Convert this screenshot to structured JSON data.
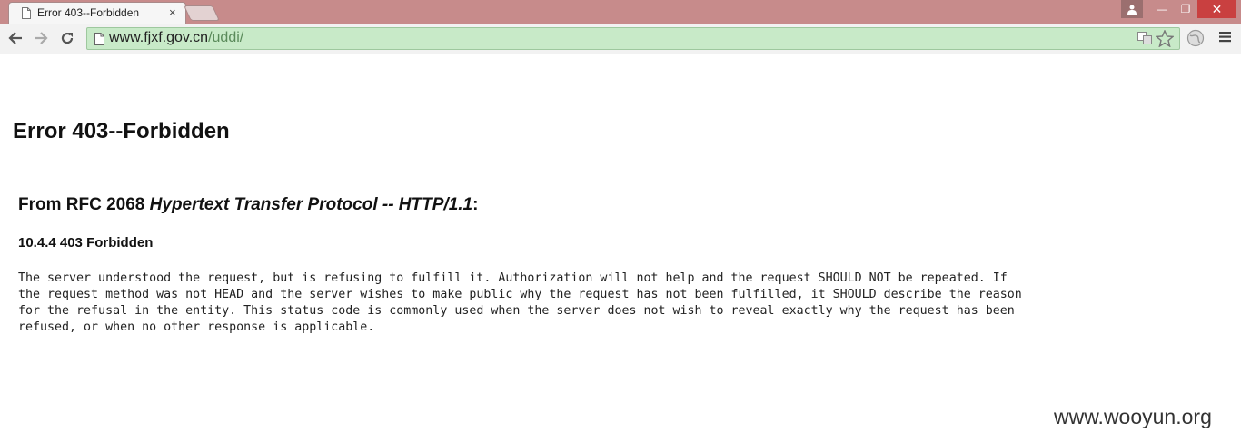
{
  "browser": {
    "tab": {
      "title": "Error 403--Forbidden",
      "close_glyph": "×"
    },
    "window_controls": {
      "user_icon": "user-icon",
      "minimize_glyph": "—",
      "maximize_glyph": "❐",
      "close_glyph": "✕"
    },
    "toolbar": {
      "url_host": "www.fjxf.gov.cn",
      "url_path": "/uddi/"
    }
  },
  "page": {
    "heading": "Error 403--Forbidden",
    "rfc_prefix": "From RFC 2068 ",
    "rfc_title": "Hypertext Transfer Protocol -- HTTP/1.1",
    "rfc_suffix": ":",
    "section_heading": "10.4.4 403 Forbidden",
    "body_lines": [
      "The server understood the request, but is refusing to fulfill it. Authorization will not help and the request SHOULD NOT be repeated. If",
      "the request method was not HEAD and the server wishes to make public why the request has not been fulfilled, it SHOULD describe the reason",
      "for the refusal in the entity. This status code is commonly used when the server does not wish to reveal exactly why the request has been",
      "refused, or when no other response is applicable."
    ]
  },
  "watermark": "www.wooyun.org",
  "colors": {
    "titlebar": "#c78b8b",
    "omnibox": "#c8eac8",
    "close_button": "#c94040"
  }
}
